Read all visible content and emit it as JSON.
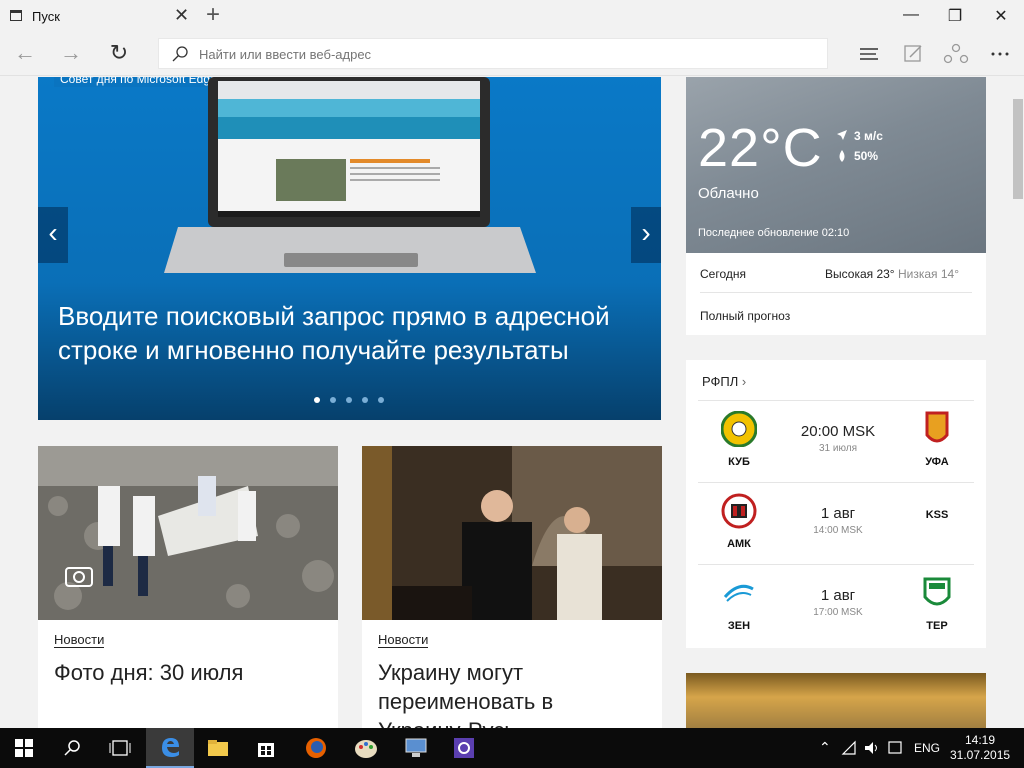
{
  "tab": {
    "title": "Пуск",
    "close": "✕",
    "new": "+"
  },
  "window": {
    "minimize": "—",
    "restore": "❐",
    "close": "✕"
  },
  "nav": {
    "back": "←",
    "forward": "→",
    "refresh": "↻"
  },
  "address": {
    "placeholder": "Найти или ввести веб-адрес"
  },
  "hero": {
    "tip": "Совет дня по Microsoft Edge",
    "heading": "Вводите поисковый запрос прямо в адресной строке и мгновенно получайте результаты",
    "prev": "‹",
    "next": "›",
    "slide_count": 5,
    "active_slide": 1
  },
  "cards": [
    {
      "category": "Новости",
      "title": "Фото дня: 30 июля"
    },
    {
      "category": "Новости",
      "title": "Украину могут переименовать в Украину-Русь"
    }
  ],
  "weather": {
    "temperature": "22°C",
    "condition": "Облачно",
    "wind": "3 м/с",
    "humidity": "50%",
    "updated": "Последнее обновление 02:10",
    "today_label": "Сегодня",
    "high": "Высокая 23°",
    "low": "Низкая 14°",
    "full_forecast": "Полный прогноз"
  },
  "rfpl": {
    "header": "РФПЛ",
    "matches": [
      {
        "home": "КУБ",
        "away": "УФА",
        "main": "20:00 MSK",
        "sub": "31 июля"
      },
      {
        "home": "АМК",
        "away": "KSS",
        "main": "1 авг",
        "sub": "14:00 MSK"
      },
      {
        "home": "ЗЕН",
        "away": "ТЕР",
        "main": "1 авг",
        "sub": "17:00 MSK"
      }
    ]
  },
  "taskbar": {
    "lang": "ENG",
    "time": "14:19",
    "date": "31.07.2015"
  },
  "colors": {
    "edge_blue": "#0a79c7",
    "taskbar": "#0b0b0b"
  }
}
